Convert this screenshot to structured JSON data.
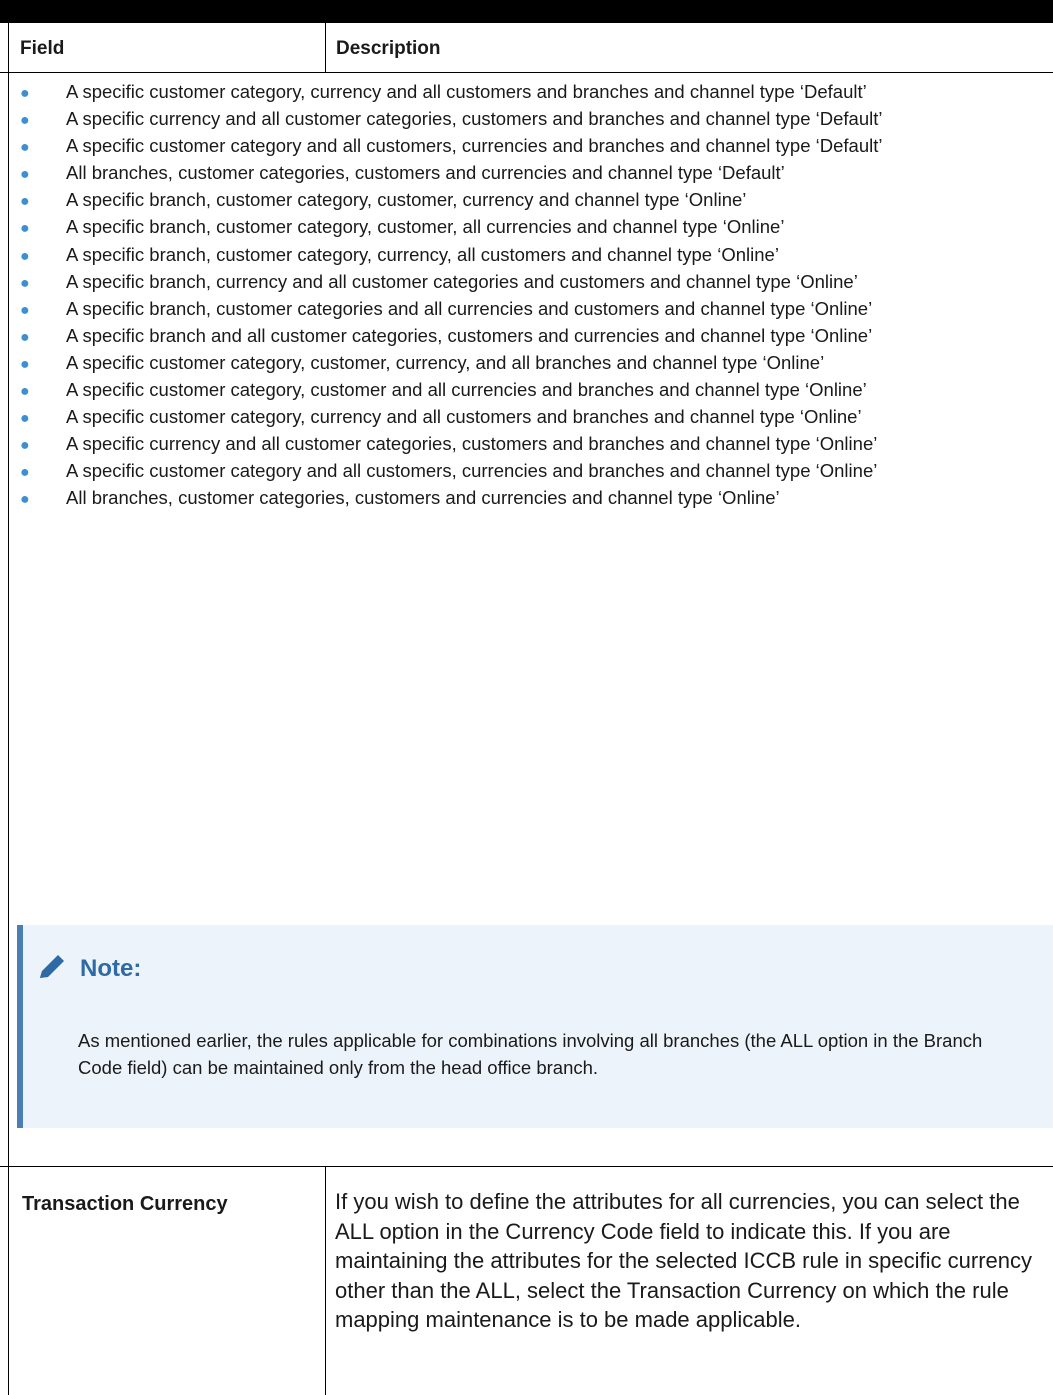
{
  "table": {
    "headers": {
      "field": "Field",
      "description": "Description"
    },
    "bullets": [
      "A specific customer category, currency and all customers and branches and channel type ‘Default’",
      "A specific currency and all customer categories, customers and branches and channel type ‘Default’",
      "A specific customer category and all customers, currencies and branches and channel type ‘Default’",
      "All branches, customer categories, customers and currencies and channel type ‘Default’",
      "A specific branch, customer category, customer, currency and channel type ‘Online’",
      "A specific branch, customer category, customer, all currencies and channel type ‘Online’",
      "A specific branch, customer category, currency, all customers and channel type ‘Online’",
      "A specific branch, currency and all customer categories and customers and channel type ‘Online’",
      "A specific branch, customer categories and all currencies and customers and channel type ‘Online’",
      "A specific branch and all customer categories, customers and currencies and channel type ‘Online’",
      "A specific customer category, customer, currency, and all branches and channel type ‘Online’",
      "A specific customer category, customer and all currencies and branches and channel type ‘Online’",
      "A specific customer category, currency and all customers and branches and channel type ‘Online’",
      "A specific currency and all customer categories, customers and branches and channel type ‘Online’",
      "A specific customer category and all customers, currencies and branches and channel type ‘Online’",
      "All branches, customer categories, customers and currencies and channel type ‘Online’"
    ],
    "note": {
      "title": "Note:",
      "icon": "pencil-icon",
      "body": "As mentioned earlier, the rules applicable for combinations involving all branches (the ALL option in the Branch Code field) can be maintained only from the head office branch."
    },
    "rows": [
      {
        "field": "Transaction Currency",
        "description": "If you wish to define the attributes for all currencies, you can select the ALL option in the Currency Code field to indicate this. If you are maintaining the attributes for the selected ICCB rule in specific currency other than the ALL, select the Transaction Currency on which the rule mapping maintenance is to be made applicable."
      }
    ]
  },
  "colors": {
    "bullet": "#3d8fd1",
    "note_bg": "#edf3fa",
    "note_border": "#4a7fb6",
    "note_title": "#2d6aa6"
  }
}
